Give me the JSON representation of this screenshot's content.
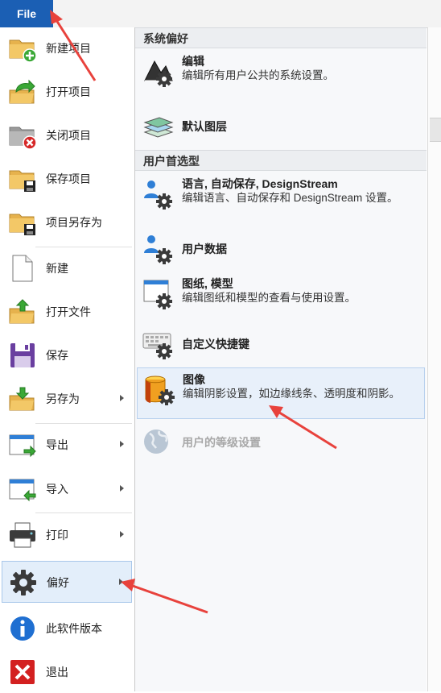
{
  "file_tab": "File",
  "left_menu": [
    {
      "label": "新建项目",
      "icon": "new-project-icon"
    },
    {
      "label": "打开项目",
      "icon": "open-project-icon"
    },
    {
      "label": "关闭项目",
      "icon": "close-project-icon"
    },
    {
      "label": "保存项目",
      "icon": "save-project-icon"
    },
    {
      "label": "项目另存为",
      "icon": "save-project-as-icon"
    },
    {
      "label": "新建",
      "icon": "new-document-icon"
    },
    {
      "label": "打开文件",
      "icon": "open-file-icon"
    },
    {
      "label": "保存",
      "icon": "floppy-save-icon"
    },
    {
      "label": "另存为",
      "icon": "save-as-folder-icon",
      "submenu": true
    },
    {
      "label": "导出",
      "icon": "export-icon",
      "submenu": true
    },
    {
      "label": "导入",
      "icon": "import-icon",
      "submenu": true
    },
    {
      "label": "打印",
      "icon": "printer-icon",
      "submenu": true
    },
    {
      "label": "偏好",
      "icon": "gear-icon",
      "submenu": true,
      "active": true
    },
    {
      "label": "此软件版本",
      "icon": "info-icon"
    },
    {
      "label": "退出",
      "icon": "exit-icon"
    }
  ],
  "submenu": {
    "section_system": "系统偏好",
    "section_user": "用户首选型",
    "items": [
      {
        "title": "编辑",
        "desc": "编辑所有用户公共的系统设置。",
        "icon": "edit-system-icon"
      },
      {
        "title": "默认图层",
        "desc": "",
        "icon": "layers-icon"
      },
      {
        "title": "语言, 自动保存, DesignStream",
        "desc": "编辑语言、自动保存和 DesignStream 设置。",
        "icon": "user-settings-icon"
      },
      {
        "title": "用户数据",
        "desc": "",
        "icon": "user-data-icon"
      },
      {
        "title": "图纸, 模型",
        "desc": "编辑图纸和模型的查看与使用设置。",
        "icon": "drawing-model-icon"
      },
      {
        "title": "自定义快捷键",
        "desc": "",
        "icon": "keyboard-icon"
      },
      {
        "title": "图像",
        "desc": "编辑阴影设置，如边缘线条、透明度和阴影。",
        "icon": "image-cylinder-icon",
        "selected": true
      },
      {
        "title": "用户的等级设置",
        "desc": "",
        "icon": "globe-icon",
        "disabled": true
      }
    ]
  },
  "colors": {
    "file_tab": "#1b5fb4",
    "active_highlight": "#e3eefa",
    "arrow": "#e8423c"
  }
}
